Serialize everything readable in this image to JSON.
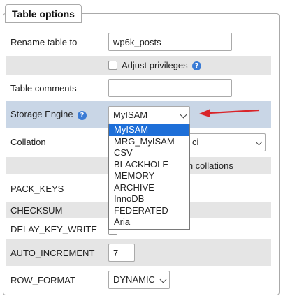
{
  "legend": "Table options",
  "rename": {
    "label": "Rename table to",
    "value": "wp6k_posts"
  },
  "privileges": {
    "label": "Adjust privileges",
    "help_icon": "help-icon"
  },
  "comments": {
    "label": "Table comments",
    "value": ""
  },
  "storage": {
    "label": "Storage Engine",
    "value": "MyISAM",
    "help_icon": "help-icon"
  },
  "collation": {
    "label": "Collation",
    "value_fragment": "ci",
    "behind_text": "mn collations"
  },
  "pack_keys": {
    "label": "PACK_KEYS"
  },
  "checksum": {
    "label": "CHECKSUM"
  },
  "delay_key_write": {
    "label": "DELAY_KEY_WRITE"
  },
  "auto_increment": {
    "label": "AUTO_INCREMENT",
    "value": "7"
  },
  "row_format": {
    "label": "ROW_FORMAT",
    "value": "DYNAMIC"
  },
  "engine_options": [
    "MyISAM",
    "MRG_MyISAM",
    "CSV",
    "BLACKHOLE",
    "MEMORY",
    "ARCHIVE",
    "InnoDB",
    "FEDERATED",
    "Aria"
  ],
  "colors": {
    "highlight": "#1e6fd8",
    "arrow": "#d9252a",
    "row_blue": "#c9d6e6",
    "row_gray": "#e5e5e5"
  }
}
